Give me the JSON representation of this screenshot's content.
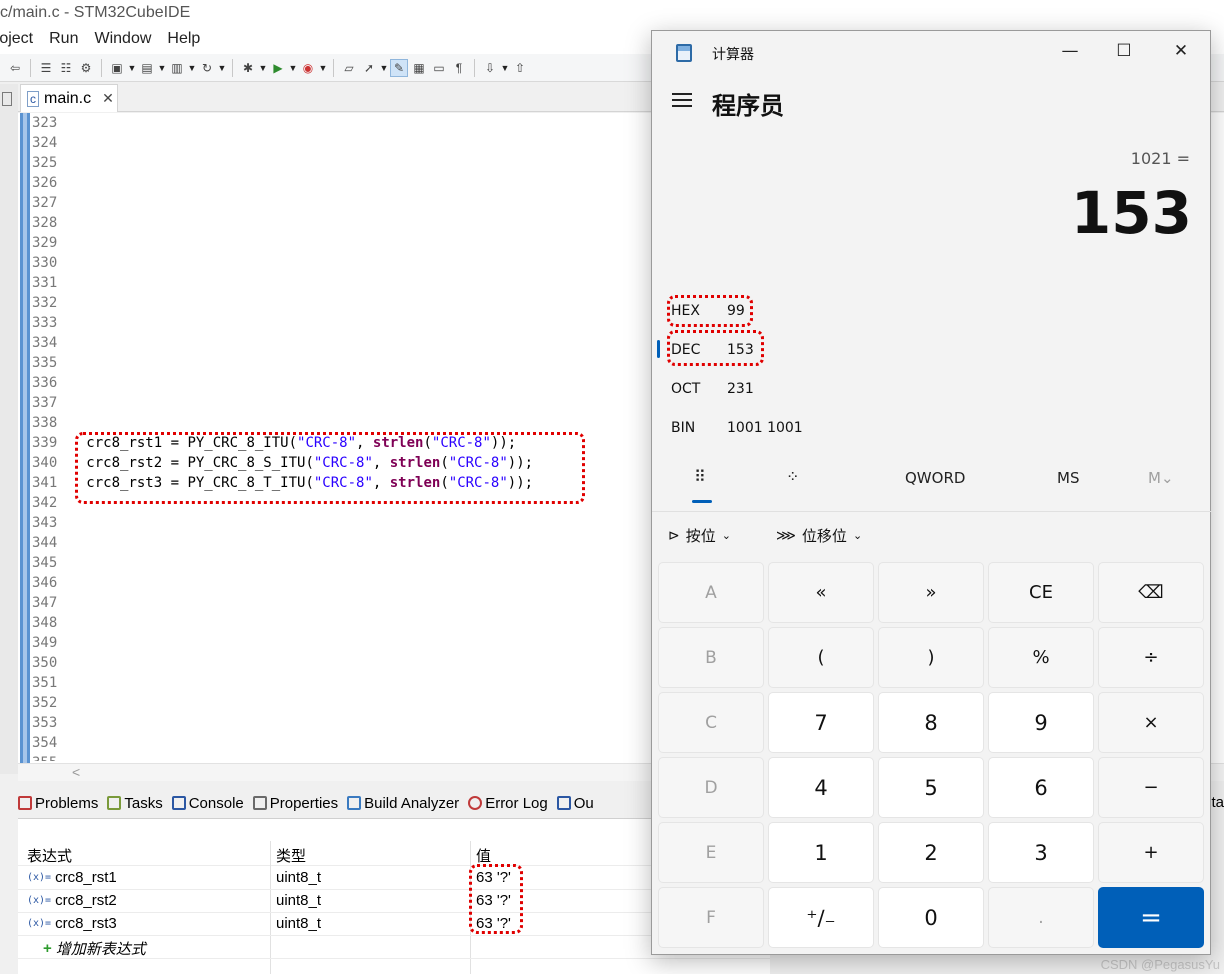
{
  "ide": {
    "window_title": "c/main.c - STM32CubeIDE",
    "menu": [
      "roject",
      "Run",
      "Window",
      "Help"
    ],
    "editor_tab": {
      "label": "main.c",
      "close": "✕"
    },
    "line_numbers": [
      "323",
      "324",
      "325",
      "326",
      "327",
      "328",
      "329",
      "330",
      "331",
      "332",
      "333",
      "334",
      "335",
      "336",
      "337",
      "338",
      "339",
      "340",
      "341",
      "342",
      "343",
      "344",
      "345",
      "346",
      "347",
      "348",
      "349",
      "350",
      "351",
      "352",
      "353",
      "354",
      "355"
    ],
    "code": {
      "l339": {
        "pre": "crc8_rst1 = PY_CRC_8_ITU(",
        "s1": "\"CRC-8\"",
        "mid": ", ",
        "kw": "strlen",
        "op": "(",
        "s2": "\"CRC-8\"",
        "end": "));"
      },
      "l340": {
        "pre": "crc8_rst2 = PY_CRC_8_S_ITU(",
        "s1": "\"CRC-8\"",
        "mid": ", ",
        "kw": "strlen",
        "op": "(",
        "s2": "\"CRC-8\"",
        "end": "));"
      },
      "l341": {
        "pre": "crc8_rst3 = PY_CRC_8_T_ITU(",
        "s1": "\"CRC-8\"",
        "mid": ", ",
        "kw": "strlen",
        "op": "(",
        "s2": "\"CRC-8\"",
        "end": "));"
      }
    },
    "view_tabs": [
      "Problems",
      "Tasks",
      "Console",
      "Properties",
      "Build Analyzer",
      "Error Log",
      "Ou"
    ],
    "view_tab_right_fragment": "ta",
    "expressions": {
      "headers": [
        "表达式",
        "类型",
        "值"
      ],
      "rows": [
        {
          "name": "crc8_rst1",
          "type": "uint8_t",
          "value": "63 '?'"
        },
        {
          "name": "crc8_rst2",
          "type": "uint8_t",
          "value": "63 '?'"
        },
        {
          "name": "crc8_rst3",
          "type": "uint8_t",
          "value": "63 '?'"
        }
      ],
      "add_label": "增加新表达式",
      "var_icon": "(x)="
    },
    "scroll_left": "<"
  },
  "calculator": {
    "title": "计算器",
    "mode": "程序员",
    "expression": "1021 =",
    "result": "153",
    "radix": [
      {
        "label": "HEX",
        "value": "99"
      },
      {
        "label": "DEC",
        "value": "153"
      },
      {
        "label": "OCT",
        "value": "231"
      },
      {
        "label": "BIN",
        "value": "1001 1001"
      }
    ],
    "active_radix": "DEC",
    "controls": {
      "word_size": "QWORD",
      "ms": "MS",
      "m_dropdown": "M⌄"
    },
    "bitwise": "按位",
    "bitshift": "位移位",
    "keys": [
      [
        "A",
        "«",
        "»",
        "CE",
        "⌫"
      ],
      [
        "B",
        "(",
        ")",
        "%",
        "÷"
      ],
      [
        "C",
        "7",
        "8",
        "9",
        "×"
      ],
      [
        "D",
        "4",
        "5",
        "6",
        "−"
      ],
      [
        "E",
        "1",
        "2",
        "3",
        "+"
      ],
      [
        "F",
        "⁺∕₋",
        "0",
        ".",
        "="
      ]
    ],
    "window_controls": {
      "minimize": "—",
      "maximize": "☐",
      "close": "✕"
    }
  },
  "watermark": "CSDN @PegasusYu",
  "colors": {
    "highlight_box": "#e00000",
    "accent": "#005fb8",
    "keyword": "#7f0055",
    "string": "#2a00ff"
  }
}
